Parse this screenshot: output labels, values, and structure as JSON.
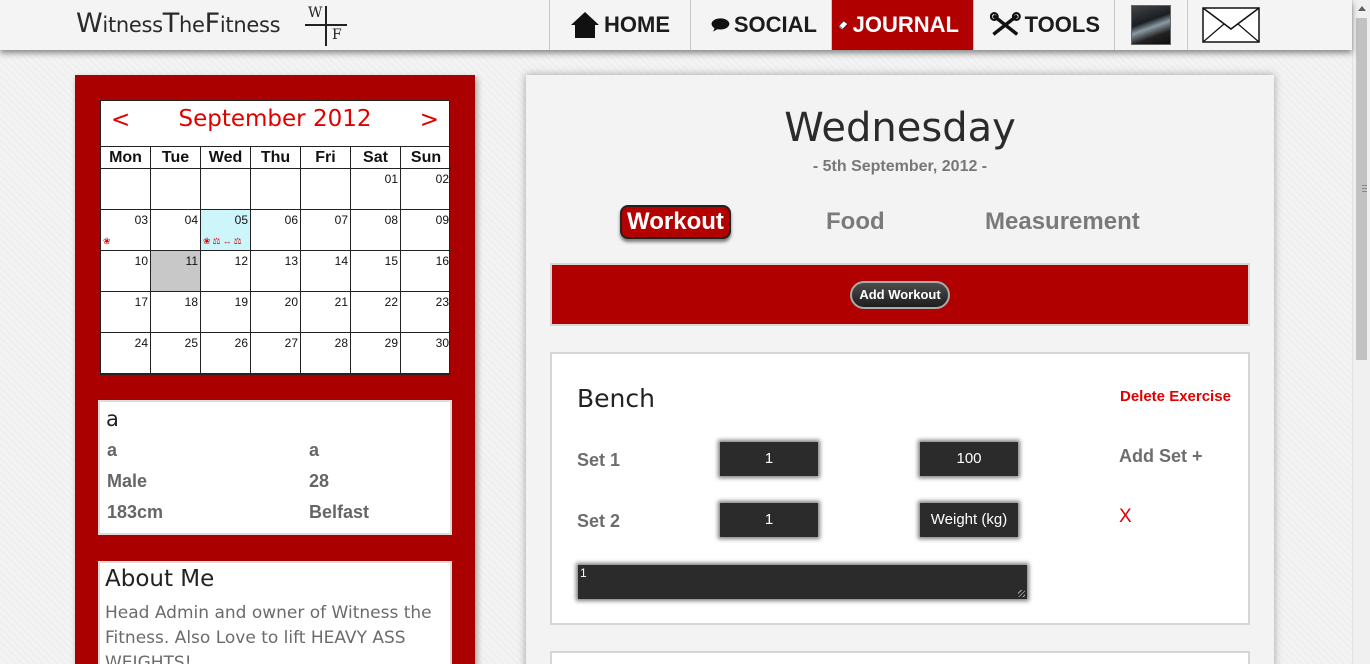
{
  "brand": {
    "name_parts": [
      "W",
      "itness",
      "T",
      "he",
      "F",
      "itness"
    ],
    "mark_w": "W",
    "mark_f": "F"
  },
  "nav": {
    "home": "HOME",
    "social": "SOCIAL",
    "journal": "JOURNAL",
    "tools": "TOOLS"
  },
  "calendar": {
    "prev": "<",
    "next": ">",
    "month": "September 2012",
    "weekdays": [
      "Mon",
      "Tue",
      "Wed",
      "Thu",
      "Fri",
      "Sat",
      "Sun"
    ],
    "weeks": [
      [
        "",
        "",
        "",
        "",
        "",
        "01",
        "02"
      ],
      [
        "03",
        "04",
        "05",
        "06",
        "07",
        "08",
        "09"
      ],
      [
        "10",
        "11",
        "12",
        "13",
        "14",
        "15",
        "16"
      ],
      [
        "17",
        "18",
        "19",
        "20",
        "21",
        "22",
        "23"
      ],
      [
        "24",
        "25",
        "26",
        "27",
        "28",
        "29",
        "30"
      ]
    ],
    "today": "11",
    "selected": "05",
    "day_icons": {
      "03": [
        "food-icon"
      ],
      "05": [
        "food-icon",
        "scale-icon",
        "dumbbell-icon",
        "scale-icon"
      ]
    }
  },
  "profile": {
    "name": "a",
    "fields": [
      "a",
      "a",
      "Male",
      "28",
      "183cm",
      "Belfast"
    ]
  },
  "about": {
    "title": "About Me",
    "text": "Head Admin and owner of Witness the Fitness. Also Love to lift HEAVY ASS WEIGHTS!"
  },
  "journal": {
    "day": "Wednesday",
    "date": "- 5th September, 2012 -",
    "tabs": {
      "workout": "Workout",
      "food": "Food",
      "measurement": "Measurement"
    },
    "active_tab": "Workout",
    "add_workout": "Add Workout"
  },
  "exercise": {
    "name": "Bench",
    "delete_label": "Delete Exercise",
    "add_set_label": "Add Set +",
    "remove_set_label": "X",
    "sets": [
      {
        "label": "Set 1",
        "reps": "1",
        "weight": "100"
      },
      {
        "label": "Set 2",
        "reps": "1",
        "weight_placeholder": "Weight (kg)"
      }
    ],
    "notes": "1"
  },
  "colors": {
    "accent": "#b00000",
    "calendar_selected": "#cdf6fb",
    "calendar_today": "#c8c8c8",
    "danger_text": "#e00000"
  }
}
